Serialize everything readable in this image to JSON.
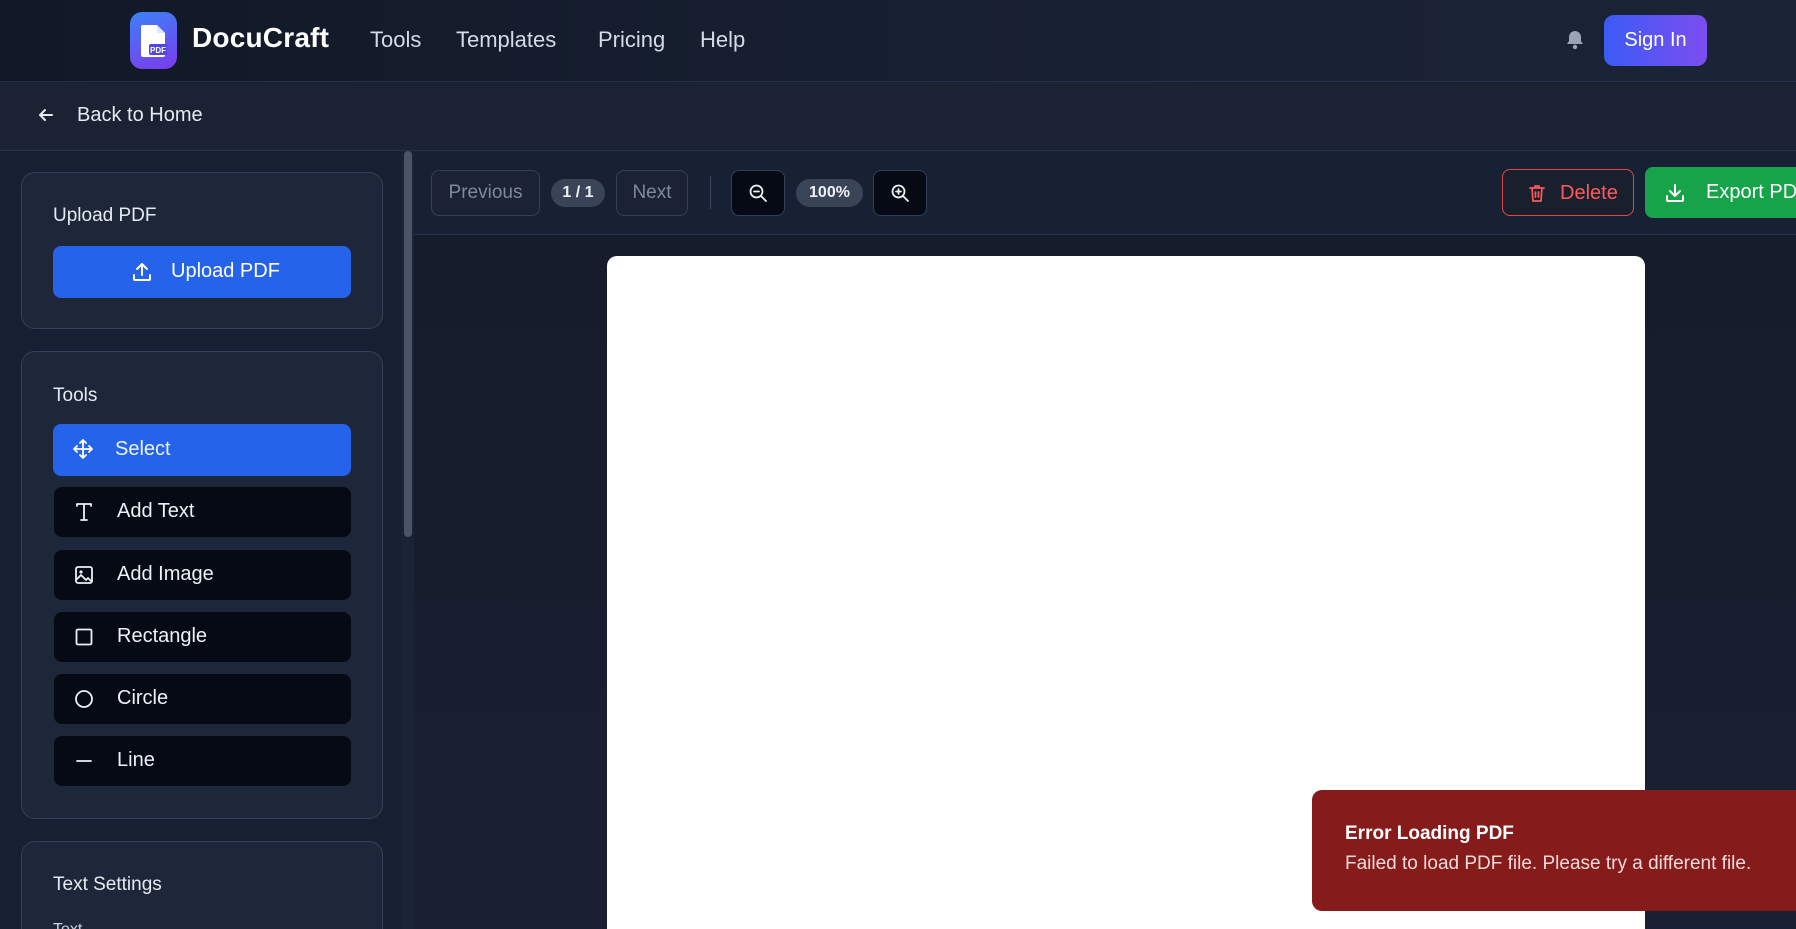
{
  "header": {
    "brand": "DocuCraft",
    "logo_text": "PDF",
    "nav": [
      "Tools",
      "Templates",
      "Pricing",
      "Help"
    ],
    "sign_in": "Sign In"
  },
  "backbar": {
    "label": "Back to Home"
  },
  "sidebar": {
    "upload": {
      "title": "Upload PDF",
      "button": "Upload PDF"
    },
    "tools": {
      "title": "Tools",
      "items": [
        {
          "label": "Select",
          "icon": "move-icon",
          "active": true
        },
        {
          "label": "Add Text",
          "icon": "text-icon",
          "active": false
        },
        {
          "label": "Add Image",
          "icon": "image-icon",
          "active": false
        },
        {
          "label": "Rectangle",
          "icon": "square-icon",
          "active": false
        },
        {
          "label": "Circle",
          "icon": "circle-icon",
          "active": false
        },
        {
          "label": "Line",
          "icon": "line-icon",
          "active": false
        }
      ]
    },
    "text_settings": {
      "title": "Text Settings",
      "field_label": "Text"
    }
  },
  "toolbar": {
    "previous": "Previous",
    "page_indicator": "1 / 1",
    "next": "Next",
    "zoom": "100%",
    "delete": "Delete",
    "export": "Export PDF"
  },
  "toast": {
    "title": "Error Loading PDF",
    "message": "Failed to load PDF file. Please try a different file."
  },
  "colors": {
    "accent": "#2563eb",
    "danger": "#ef4444",
    "success": "#16a34a",
    "toast_bg": "#861b1b"
  }
}
